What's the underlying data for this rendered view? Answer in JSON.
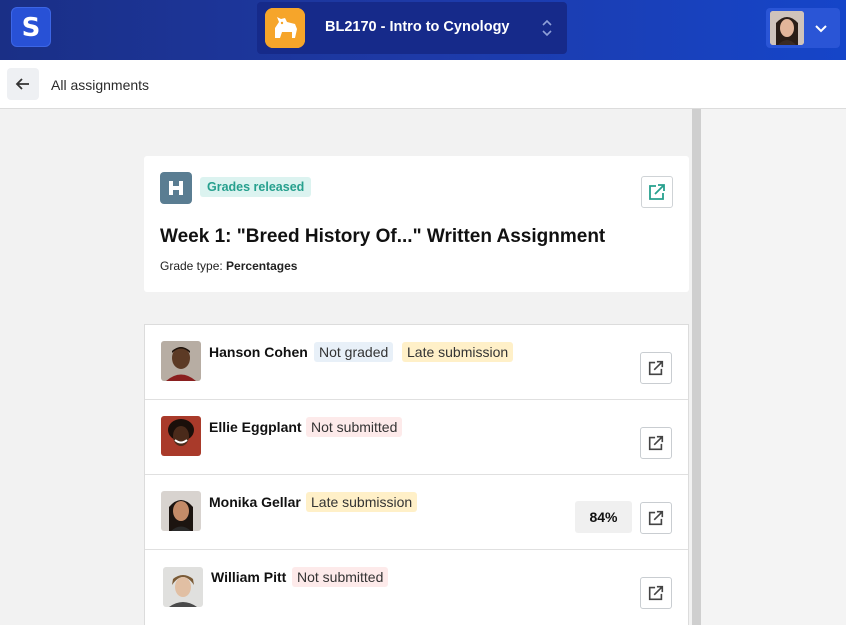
{
  "topbar": {
    "app_icon": "s-logo-icon",
    "course": {
      "title": "BL2170 - Intro to Cynology",
      "icon": "dog-icon",
      "switch_icon": "chevron-up-down-icon"
    },
    "user": {
      "avatar": "user-avatar",
      "menu_icon": "chevron-down-icon"
    }
  },
  "subheader": {
    "back_icon": "arrow-left-icon",
    "back_label": "All assignments"
  },
  "assignment": {
    "source_icon": "h-logo-icon",
    "status_badge": "Grades released",
    "title": "Week 1: \"Breed History Of...\" Written Assignment",
    "grade_type_label": "Grade type:",
    "grade_type_value": "Percentages",
    "open_icon": "external-link-icon"
  },
  "students": [
    {
      "name": "Hanson Cohen",
      "tags": [
        "Not graded",
        "Late submission"
      ],
      "score": ""
    },
    {
      "name": "Ellie Eggplant",
      "tags": [
        "Not submitted"
      ],
      "score": ""
    },
    {
      "name": "Monika Gellar",
      "tags": [
        "Late submission"
      ],
      "score": "84%"
    },
    {
      "name": "William Pitt",
      "tags": [
        "Not submitted"
      ],
      "score": ""
    }
  ],
  "colors": {
    "topbar": "#1e3aa8",
    "badge_released_bg": "#dcf3f0",
    "badge_released_text": "#27a08e",
    "tag_not_graded": "#e8f0f8",
    "tag_late": "#fff0c8",
    "tag_not_submitted": "#fdeaea"
  }
}
